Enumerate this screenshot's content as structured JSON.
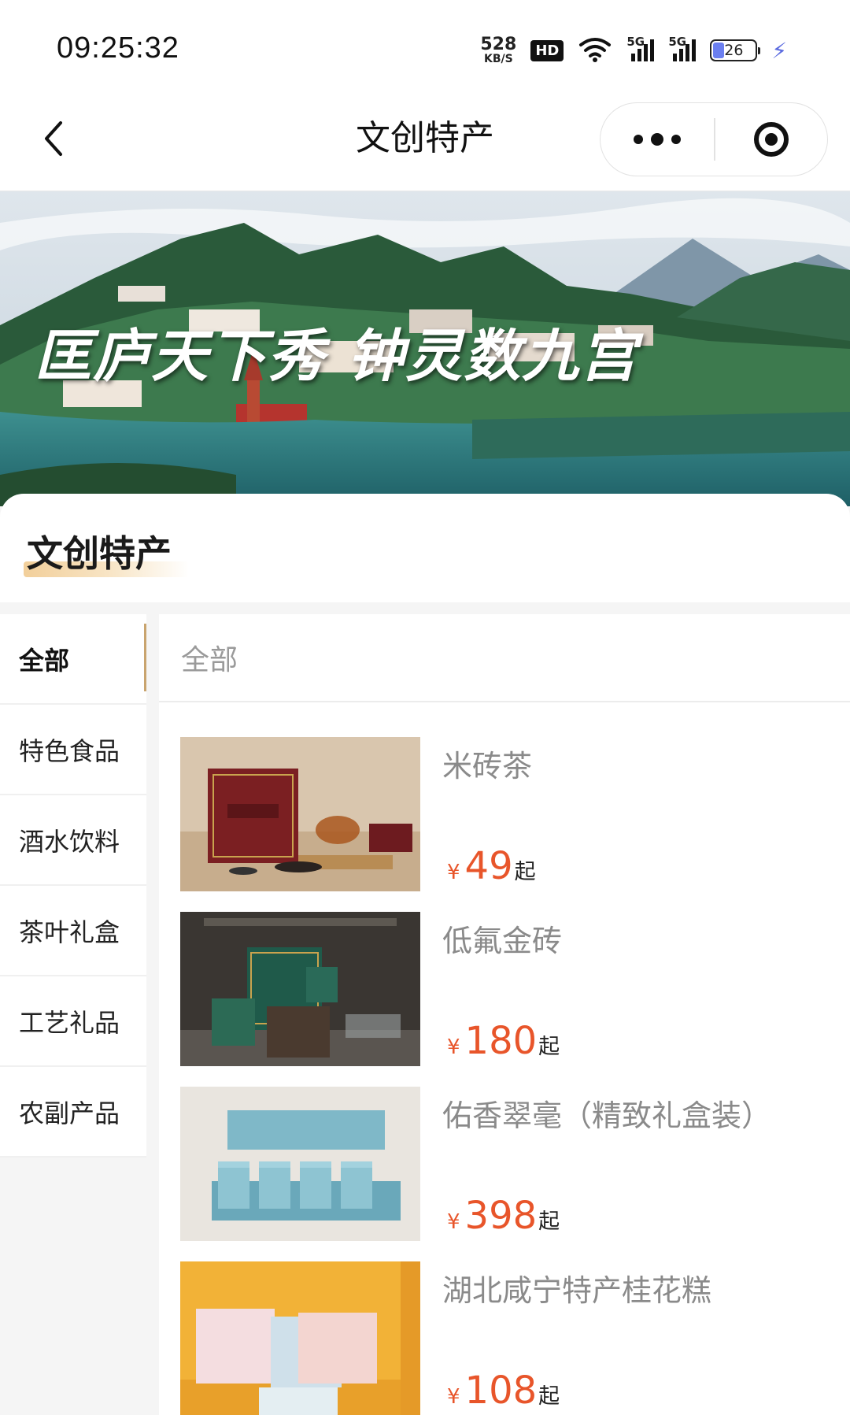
{
  "status_bar": {
    "time": "09:25:32",
    "net_speed": "528",
    "net_unit": "KB/S",
    "hd_badge": "HD",
    "signal_1": "5G",
    "signal_2": "5G",
    "battery": "26",
    "battery_level_percent": 26
  },
  "nav": {
    "title": "文创特产"
  },
  "banner": {
    "text": "匡庐天下秀 钟灵数九宫"
  },
  "section": {
    "title": "文创特产"
  },
  "categories": [
    {
      "label": "全部",
      "active": true
    },
    {
      "label": "特色食品",
      "active": false
    },
    {
      "label": "酒水饮料",
      "active": false
    },
    {
      "label": "茶叶礼盒",
      "active": false
    },
    {
      "label": "工艺礼品",
      "active": false
    },
    {
      "label": "农副产品",
      "active": false
    }
  ],
  "content": {
    "header": "全部",
    "products": [
      {
        "name": "米砖茶",
        "currency": "¥",
        "price": "49",
        "suffix": "起"
      },
      {
        "name": "低氟金砖",
        "currency": "¥",
        "price": "180",
        "suffix": "起"
      },
      {
        "name": "佑香翠毫（精致礼盒装）",
        "currency": "¥",
        "price": "398",
        "suffix": "起"
      },
      {
        "name": "湖北咸宁特产桂花糕",
        "currency": "¥",
        "price": "108",
        "suffix": "起"
      }
    ]
  },
  "colors": {
    "price": "#e8552a",
    "active_indicator": "#c9a46e",
    "accent_gold": "#f2cf9a"
  },
  "icons": [
    "back-arrow-icon",
    "more-dots-icon",
    "close-target-icon",
    "wifi-icon",
    "signal-icon",
    "battery-icon",
    "charging-bolt-icon"
  ]
}
